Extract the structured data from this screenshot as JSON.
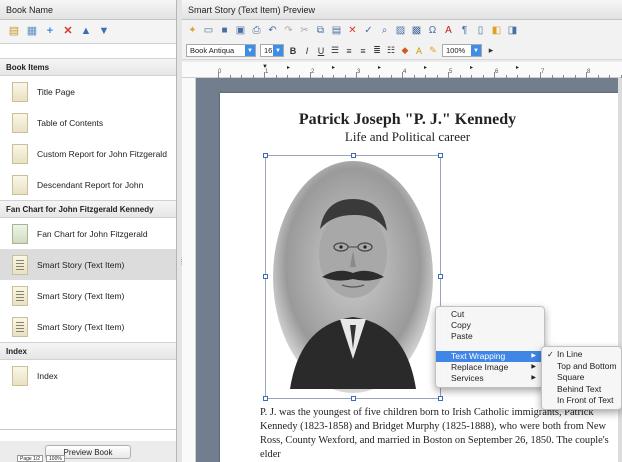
{
  "left_panel": {
    "title": "Book Name",
    "sections": [
      {
        "label": "Book Items",
        "items": [
          {
            "label": "Title Page",
            "icon": "document-icon",
            "selected": false
          },
          {
            "label": "Table of Contents",
            "icon": "document-icon",
            "selected": false
          },
          {
            "label": "Custom Report for John Fitzgerald",
            "icon": "document-icon",
            "selected": false
          },
          {
            "label": "Descendant Report for John",
            "icon": "document-icon",
            "selected": false
          }
        ]
      },
      {
        "label": "Fan Chart for John Fitzgerald Kennedy",
        "items": [
          {
            "label": "Fan Chart for John Fitzgerald",
            "icon": "fan-chart-icon",
            "selected": false
          },
          {
            "label": "Smart Story (Text Item)",
            "icon": "smart-story-icon",
            "selected": true
          },
          {
            "label": "Smart Story (Text Item)",
            "icon": "smart-story-icon",
            "selected": false
          },
          {
            "label": "Smart Story (Text Item)",
            "icon": "smart-story-icon",
            "selected": false
          }
        ]
      },
      {
        "label": "Index",
        "items": [
          {
            "label": "Index",
            "icon": "document-icon",
            "selected": false
          }
        ]
      }
    ],
    "preview_button": "Preview Book"
  },
  "right_panel": {
    "title": "Smart Story (Text Item) Preview",
    "font_name": "Book Antiqua",
    "font_size": "16",
    "zoom": "100%",
    "ruler_numbers": [
      "0",
      "1",
      "2",
      "3",
      "4",
      "5",
      "6",
      "7",
      "8"
    ],
    "page": {
      "title": "Patrick Joseph \"P. J.\" Kennedy",
      "subtitle": "Life and Political career",
      "body": "P. J. was the youngest of five children born to Irish Catholic immigrants, Patrick Kennedy (1823-1858) and Bridget Murphy (1825-1888), who were both from New Ross, County Wexford, and married in Boston on September 26, 1850. The couple's elder"
    },
    "status": {
      "page": "Page 1/2",
      "zoom": "100%"
    }
  },
  "context_menu": {
    "items": [
      "Cut",
      "Copy",
      "Paste"
    ],
    "submenu_items": [
      {
        "label": "Text Wrapping",
        "highlighted": true
      },
      {
        "label": "Replace Image",
        "highlighted": false
      },
      {
        "label": "Services",
        "highlighted": false
      }
    ]
  },
  "wrap_submenu": {
    "items": [
      {
        "label": "In Line",
        "checked": true
      },
      {
        "label": "Top and Bottom",
        "checked": false
      },
      {
        "label": "Square",
        "checked": false
      },
      {
        "label": "Behind Text",
        "checked": false
      },
      {
        "label": "In Front of Text",
        "checked": false
      }
    ]
  },
  "colors": {
    "accent": "#3f86e6",
    "canvas": "#727e8e",
    "selected_row": "#dcdcdc"
  }
}
